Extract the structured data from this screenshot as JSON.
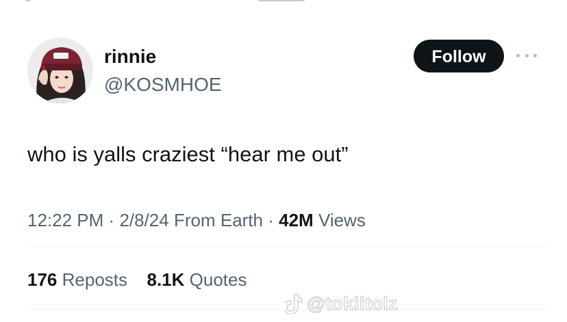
{
  "tweet": {
    "author": {
      "display_name": "rinnie",
      "handle": "@KOSMHOE"
    },
    "follow_label": "Follow",
    "text": "who is yalls craziest “hear me out”",
    "time": "12:22 PM",
    "separator": "·",
    "date": "2/8/24",
    "source": "From Earth",
    "views_count": "42M",
    "views_label": "Views",
    "reposts_count": "176",
    "reposts_label": "Reposts",
    "quotes_count": "8.1K",
    "quotes_label": "Quotes"
  },
  "watermark": {
    "text": "@tokiitolz",
    "icon": "tiktok-icon"
  },
  "colors": {
    "text_primary": "#0f1419",
    "text_secondary": "#536471",
    "follow_bg": "#0f1419",
    "follow_text": "#ffffff",
    "divider": "#eff3f4"
  }
}
